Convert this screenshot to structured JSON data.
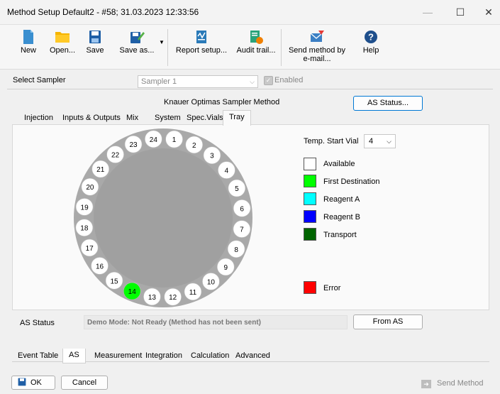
{
  "window": {
    "title": "Method Setup Default2 - #58;  31.03.2023  12:33:56",
    "minimize": "—",
    "maximize": "☐",
    "close": "✕"
  },
  "toolbar": {
    "new": "New",
    "open": "Open...",
    "save": "Save",
    "save_as": "Save as...",
    "report_setup": "Report setup...",
    "audit_trail": "Audit trail...",
    "send_method_line1": "Send method by",
    "send_method_line2": "e-mail...",
    "help": "Help"
  },
  "sampler": {
    "label": "Select Sampler",
    "value": "Sampler 1",
    "enabled_label": "Enabled"
  },
  "method": {
    "title": "Knauer Optimas Sampler Method",
    "as_status_button": "AS Status..."
  },
  "tabs": [
    "Injection",
    "Inputs & Outputs",
    "Mix",
    "System",
    "Spec.Vials",
    "Tray"
  ],
  "tray": {
    "temp_start_vial_label": "Temp. Start Vial",
    "temp_start_vial_value": "4",
    "vials": [
      1,
      2,
      3,
      4,
      5,
      6,
      7,
      8,
      9,
      10,
      11,
      12,
      13,
      14,
      15,
      16,
      17,
      18,
      19,
      20,
      21,
      22,
      23,
      24
    ],
    "first_destination_vial": 14,
    "legend": [
      {
        "label": "Available",
        "color": "#ffffff"
      },
      {
        "label": "First Destination",
        "color": "#00ff00"
      },
      {
        "label": "Reagent A",
        "color": "#00ffff"
      },
      {
        "label": "Reagent B",
        "color": "#0000ff"
      },
      {
        "label": "Transport",
        "color": "#006400"
      },
      {
        "label": "Error",
        "color": "#ff0000"
      }
    ]
  },
  "status": {
    "label": "AS Status",
    "text": "Demo Mode: Not Ready (Method has not been sent)",
    "from_as_button": "From AS"
  },
  "bottom_tabs": [
    "Event Table",
    "AS",
    "Measurement",
    "Integration",
    "Calculation",
    "Advanced"
  ],
  "footer": {
    "ok": "OK",
    "cancel": "Cancel",
    "send_method": "Send Method"
  }
}
